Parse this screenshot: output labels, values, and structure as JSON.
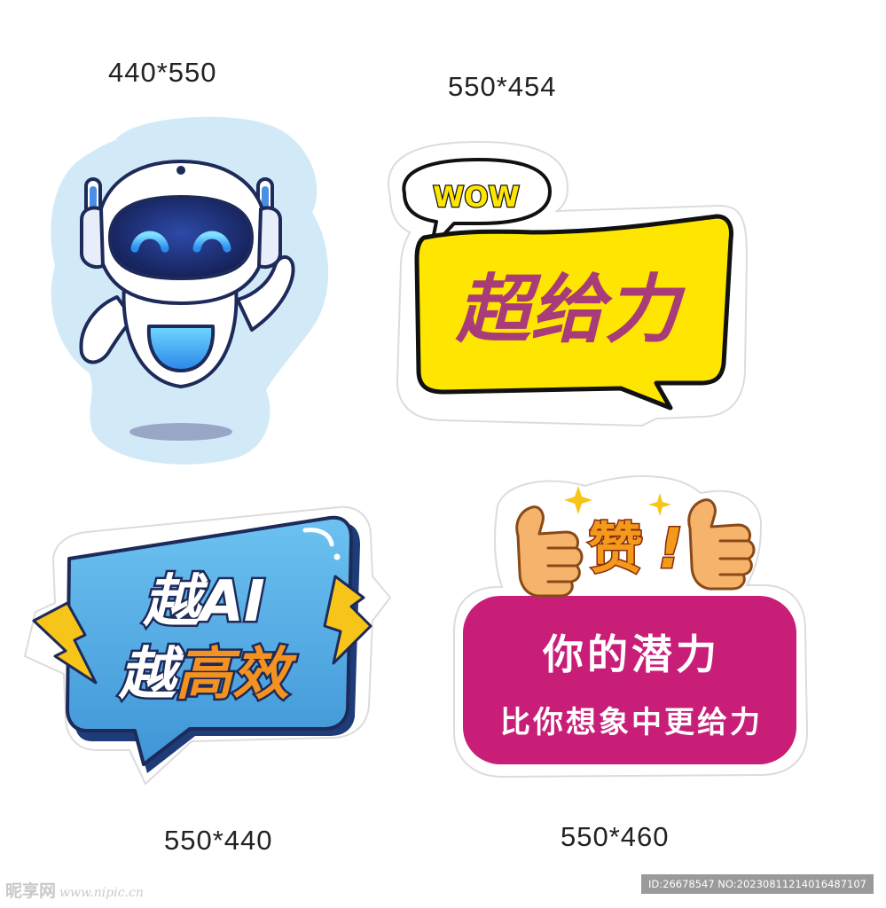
{
  "stickers": {
    "robot": {
      "size_label": "440*550"
    },
    "wow": {
      "size_label": "550*454",
      "bubble_text": "WOW",
      "main_text": "超给力"
    },
    "ai": {
      "size_label": "550*440",
      "line1": "越AI",
      "line2_prefix": "越",
      "line2_highlight": "高效"
    },
    "praise": {
      "size_label": "550*460",
      "title": "赞",
      "exclaim": "!",
      "line1": "你的潜力",
      "line2": "比你想象中更给力"
    }
  },
  "footer": {
    "watermark_cn": "昵享网",
    "watermark_url": "www.nipic.cn",
    "id_text": "ID:26678547 NO:20230811214016487107"
  },
  "colors": {
    "robot_halo": "#d2eaf8",
    "robot_visor": "#1f2f6e",
    "robot_eye": "#4cc8ff",
    "outline": "#1d2a5a",
    "wow_yellow": "#ffe600",
    "wow_text": "#a83c78",
    "ai_blue": "#5cb3e6",
    "ai_bolt": "#f7c51a",
    "ai_orange": "#f39220",
    "praise_magenta": "#c81e78",
    "praise_title": "#f39a1c",
    "thumb_skin": "#f5b36b"
  },
  "icons": [
    "robot-icon",
    "speech-bubble-icon",
    "lightning-bolt-icon",
    "thumbs-up-icon",
    "sparkle-icon"
  ]
}
